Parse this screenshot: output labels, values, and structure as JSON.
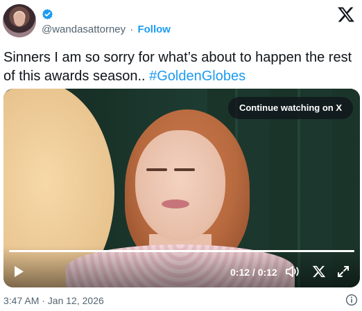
{
  "author": {
    "handle": "@wandasattorney",
    "separator": "·",
    "follow_label": "Follow",
    "verified": true
  },
  "tweet": {
    "text": "Sinners I am so sorry for what’s about to happen the rest of this awards season.. ",
    "hashtag": "#GoldenGlobes"
  },
  "video": {
    "continue_label": "Continue watching on X",
    "time_display": "0:12 / 0:12",
    "progress": 1.0
  },
  "footer": {
    "timestamp": "3:47 AM · Jan 12, 2026"
  },
  "icons": {
    "verified": "verified-badge-icon",
    "brand": "x-logo-icon",
    "play": "play-icon",
    "volume": "volume-icon",
    "x_small": "x-logo-icon",
    "expand": "expand-icon",
    "info": "info-icon"
  },
  "colors": {
    "link": "#1d9bf0",
    "text": "#0f1419",
    "muted": "#536471"
  }
}
